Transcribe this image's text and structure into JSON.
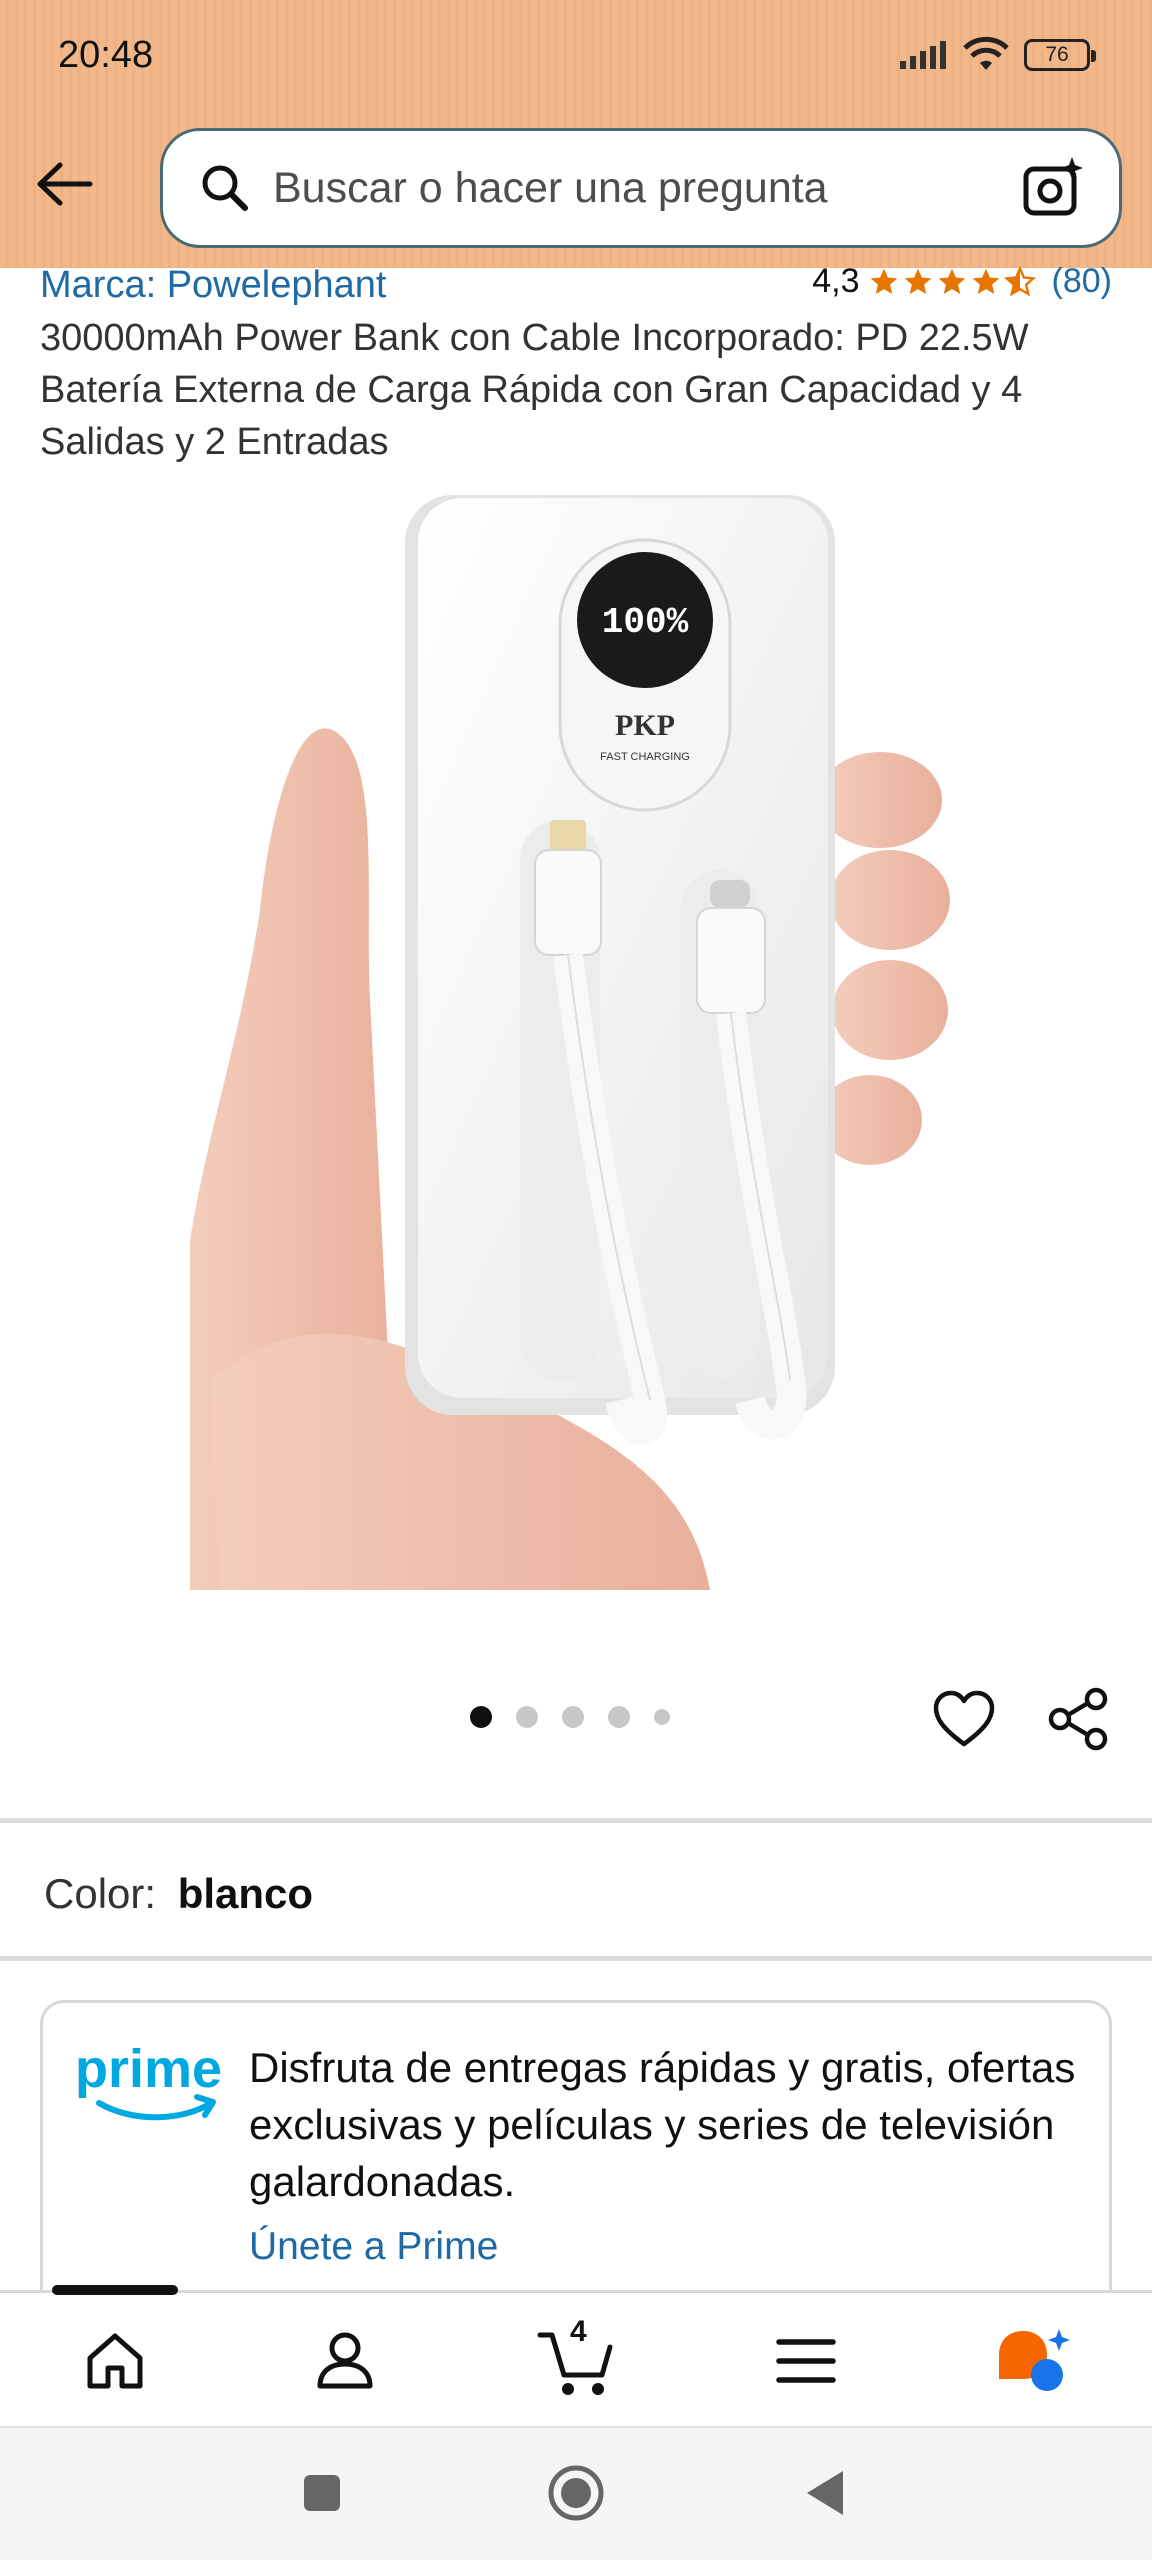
{
  "status_bar": {
    "time": "20:48",
    "battery": "76"
  },
  "search": {
    "placeholder": "Buscar o hacer una pregunta"
  },
  "product": {
    "brand": "Marca: Powelephant",
    "rating_value": "4,3",
    "rating_count": "(80)",
    "rating_stars": 4.3,
    "title": "30000mAh Power Bank con Cable Incorporado: PD 22.5W Batería Externa de Carga Rápida con Gran Capacidad y 4 Salidas y 2 Entradas",
    "image_display_text": "100%",
    "image_brand_text": "PKP",
    "image_sub_text": "FAST CHARGING"
  },
  "carousel": {
    "count": 5,
    "active_index": 0
  },
  "color": {
    "label": "Color:",
    "value": "blanco"
  },
  "prime": {
    "logo_text": "prime",
    "description": "Disfruta de entregas rápidas y gratis, ofertas exclusivas y películas y series de televisión galardonadas.",
    "link": "Únete a Prime"
  },
  "bottom_nav": {
    "items": [
      "home-icon",
      "account-icon",
      "cart-icon",
      "menu-icon",
      "rufus-icon"
    ],
    "cart_count": "4"
  },
  "colors": {
    "header_bg": "#f2b889",
    "link_blue": "#1f6aa5",
    "star_orange": "#e77600",
    "prime_blue": "#00a8e1"
  }
}
